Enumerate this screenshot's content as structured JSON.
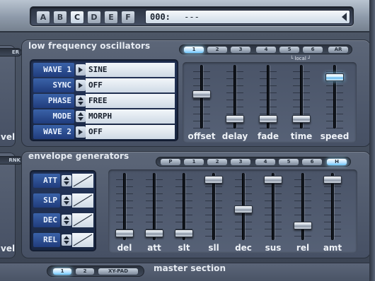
{
  "preset": {
    "slots": [
      "A",
      "B",
      "C",
      "D",
      "E",
      "F"
    ],
    "active_slot": "C",
    "number": "000:",
    "name": "---"
  },
  "lfo": {
    "title": "low frequency oscillators",
    "tabs": [
      "1",
      "2",
      "3",
      "4",
      "5",
      "6",
      "AR"
    ],
    "local_label": "local",
    "params": [
      {
        "label": "WAVE 1",
        "value": "SINE",
        "control": "triangle"
      },
      {
        "label": "SYNC",
        "value": "OFF",
        "control": "triangle"
      },
      {
        "label": "PHASE",
        "value": "FREE",
        "control": "updown"
      },
      {
        "label": "MODE",
        "value": "MORPH",
        "control": "updown"
      },
      {
        "label": "WAVE 2",
        "value": "OFF",
        "control": "triangle"
      }
    ],
    "sliders": [
      {
        "label": "offset",
        "level": 0.55
      },
      {
        "label": "delay",
        "level": 0.1
      },
      {
        "label": "fade",
        "level": 0.1
      },
      {
        "label": "time",
        "level": 0.1
      },
      {
        "label": "speed",
        "level": 0.85,
        "highlight": true
      }
    ]
  },
  "env": {
    "title": "envelope generators",
    "tabs": [
      "P",
      "1",
      "2",
      "3",
      "4",
      "5",
      "6",
      "H"
    ],
    "params": [
      "ATT",
      "SLP",
      "DEC",
      "REL"
    ],
    "sliders": [
      {
        "label": "del",
        "level": 0.05
      },
      {
        "label": "att",
        "level": 0.05
      },
      {
        "label": "slt",
        "level": 0.05
      },
      {
        "label": "sll",
        "level": 0.95
      },
      {
        "label": "dec",
        "level": 0.45
      },
      {
        "label": "sus",
        "level": 0.95
      },
      {
        "label": "rel",
        "level": 0.18
      },
      {
        "label": "amt",
        "level": 0.95
      }
    ]
  },
  "left_fragments": {
    "top_tab": "ER",
    "top_text": "vel",
    "bottom_tab": "RNK",
    "bottom_text": "vel"
  },
  "master": {
    "title": "master section",
    "tabs": [
      "1",
      "2",
      "XY-PAD"
    ]
  }
}
